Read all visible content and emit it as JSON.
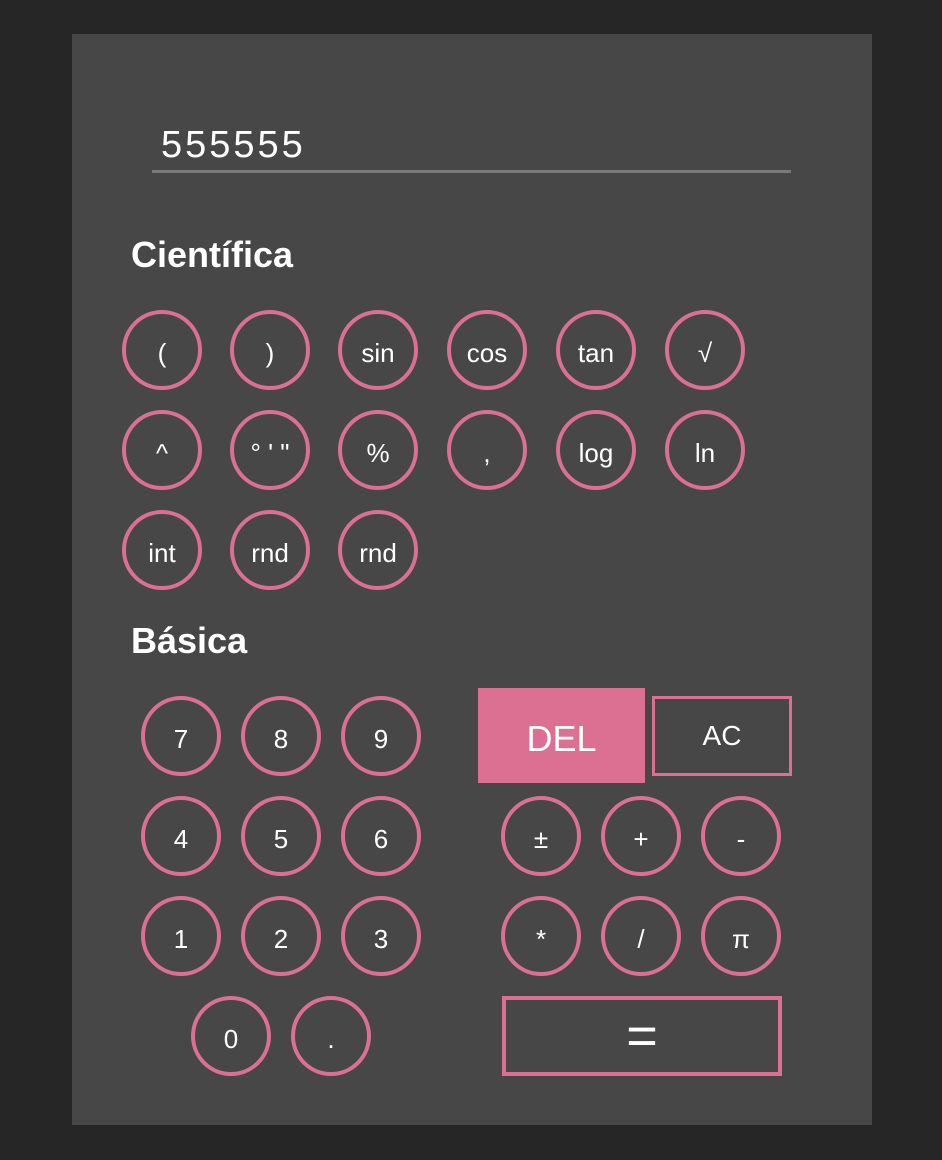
{
  "display": {
    "value": "555555"
  },
  "scientific": {
    "title": "Científica",
    "buttons": [
      "(",
      ")",
      "sin",
      "cos",
      "tan",
      "√",
      "^",
      "° ' \"",
      "%",
      ",",
      "log",
      "ln",
      "int",
      "rnd",
      "rnd"
    ]
  },
  "basic": {
    "title": "Básica",
    "digits": [
      "7",
      "8",
      "9",
      "4",
      "5",
      "6",
      "1",
      "2",
      "3",
      "0",
      "."
    ],
    "del_label": "DEL",
    "ac_label": "AC",
    "operators": [
      "±",
      "+",
      "-",
      "*",
      "/",
      "π"
    ],
    "equals_label": "="
  },
  "colors": {
    "accent": "#db7092",
    "panel": "#474747",
    "background": "#262626"
  }
}
